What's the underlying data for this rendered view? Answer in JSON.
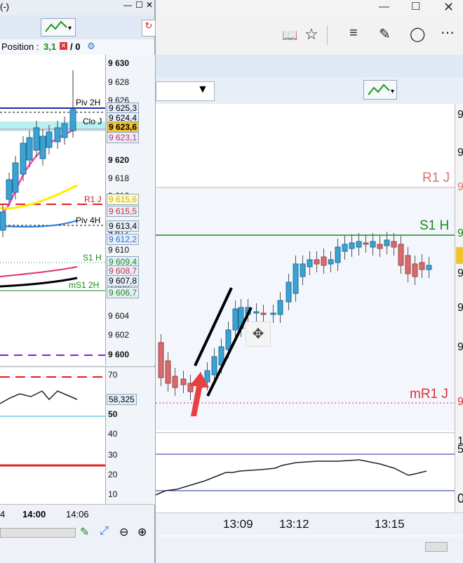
{
  "left_window": {
    "title": "(-)",
    "position": {
      "label": "Position :",
      "qty": "3,1",
      "orders": "/ 0"
    },
    "price_axis": [
      "9 630",
      "9 628",
      "9 626",
      "9 622",
      "9 620",
      "9 618",
      "9 616",
      "9 614",
      "9 612",
      "9 610",
      "9 608",
      "9 606",
      "9 604",
      "9 602",
      "9 600"
    ],
    "price_tags": [
      {
        "name": "Piv 2H",
        "value": "9 625,3"
      },
      {
        "name": "",
        "value": "9 624,4"
      },
      {
        "name": "Clo J",
        "value": "9 623,6"
      },
      {
        "name": "",
        "value": "9 623,1"
      },
      {
        "name": "R1 J",
        "value": "9 615,6"
      },
      {
        "name": "",
        "value": "9 615,5"
      },
      {
        "name": "Piv 4H",
        "value": "9 613,4"
      },
      {
        "name": "",
        "value": "9 612,2"
      },
      {
        "name": "S1 H",
        "value": "9 609,4"
      },
      {
        "name": "",
        "value": "9 608,7"
      },
      {
        "name": "",
        "value": "9 607,8"
      },
      {
        "name": "mS1 2H",
        "value": "9 606,7"
      }
    ],
    "indicator_axis": [
      "70",
      "50",
      "40",
      "30",
      "20",
      "10"
    ],
    "indicator_value": "58,325",
    "time_labels": [
      "4",
      "14:00",
      "14:06"
    ]
  },
  "right_window": {
    "level_labels": {
      "r1j": "R1 J",
      "s1h": "S1 H",
      "mr1j": "mR1 J"
    },
    "axis_fragments": [
      "9",
      "9",
      "9",
      "9",
      "9",
      "9",
      "9",
      "9",
      "9",
      "1",
      "5",
      "0"
    ],
    "time_labels": [
      "13:09",
      "13:12",
      "13:15"
    ]
  },
  "browser_toolbar": {
    "icons": [
      "reading-view-icon",
      "favorite-star-icon",
      "hub-icon",
      "annotate-icon",
      "share-icon",
      "more-icon"
    ]
  },
  "colors": {
    "bull": "#3aa3d4",
    "bear": "#d86a6a",
    "r1": "#e26b6b",
    "s1": "#1a8a1a",
    "arrow": "#e84040",
    "pivot": "#1c2ba8",
    "ma_pink": "#ff3fbf",
    "ma_yellow": "#ffee00"
  }
}
